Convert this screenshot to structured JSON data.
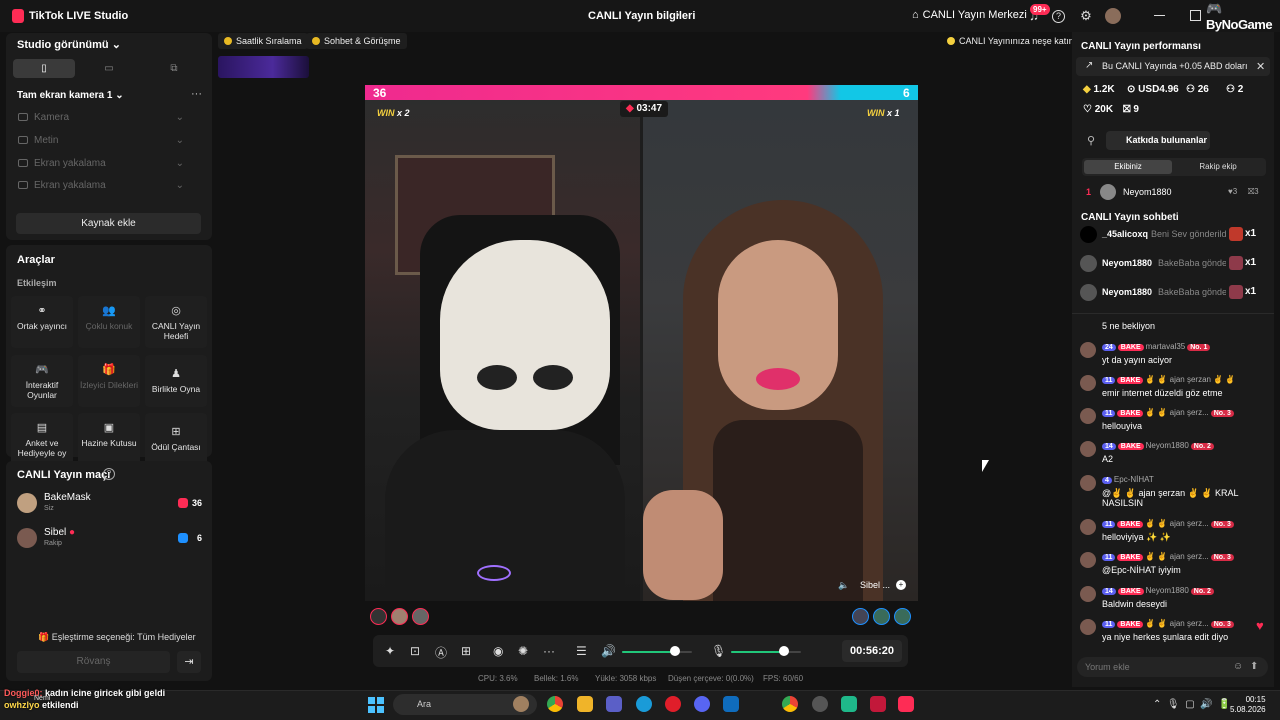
{
  "app": {
    "title": "TikTok LIVE Studio",
    "stream_info": "CANLI Yayın bilgileri",
    "center_link": "CANLI Yayın Merkezi",
    "notif_count": "99+",
    "watermark": "ByNoGame"
  },
  "left": {
    "studio_view": "Studio görünümü",
    "source_group": "Tam ekran kamera 1",
    "sources": [
      "Kamera",
      "Metin",
      "Ekran yakalama",
      "Ekran yakalama"
    ],
    "add_source": "Kaynak ekle",
    "tools_title": "Araçlar",
    "interaction_title": "Etkileşim",
    "tools": [
      {
        "label": "Ortak yayıncı",
        "icon": "link-icon"
      },
      {
        "label": "Çoklu konuk",
        "icon": "users-icon"
      },
      {
        "label": "CANLI Yayın Hedefi",
        "icon": "target-icon"
      },
      {
        "label": "İnteraktif Oyunlar",
        "icon": "gamepad-icon"
      },
      {
        "label": "İzleyici Dilekleri",
        "icon": "gift-icon"
      },
      {
        "label": "Birlikte Oyna",
        "icon": "play-together-icon"
      },
      {
        "label": "Anket ve Hediyeyle oy",
        "icon": "poll-icon"
      },
      {
        "label": "Hazine Kutusu",
        "icon": "treasure-icon"
      },
      {
        "label": "Ödül Çantası",
        "icon": "bag-icon"
      }
    ],
    "match_title": "CANLI Yayın maçı",
    "match": [
      {
        "name": "BakeMask",
        "role": "Siz",
        "score": "36",
        "color": "#fe2c55"
      },
      {
        "name": "Sibel",
        "role": "Rakip",
        "score": "6",
        "color": "#1e90ff"
      }
    ],
    "pairing": "Eşleştirme seçeneği: Tüm Hediyeler",
    "rematch": "Rövanş"
  },
  "center": {
    "chips": [
      "Saatlik Sıralama",
      "Sohbet & Görüşme",
      "CANLI Yayınınıza neşe katın"
    ],
    "score_left": "36",
    "score_right": "6",
    "timer": "03:47",
    "win_left": "x 2",
    "win_right": "x 1",
    "win_word": "WIN",
    "opponent_label": "Sibel ...",
    "elapsed": "00:56:20",
    "stats": {
      "cpu": "CPU: 3.6%",
      "mem": "Bellek: 1.6%",
      "upload": "Yükle: 3058 kbps",
      "dropped": "Düşen çerçeve: 0(0.0%)",
      "fps": "FPS: 60/60"
    },
    "volume_level": 0.75,
    "mic_level": 0.75
  },
  "right": {
    "perf_title": "CANLI Yayın performansı",
    "earn_banner": "Bu CANLI Yayında +0.05 ABD doları",
    "stats": [
      "1.2K",
      "USD4.96",
      "26",
      "2",
      "20K",
      "9"
    ],
    "contributors_btn": "Katkıda bulunanlar",
    "tab_our": "Ekibiniz",
    "tab_rival": "Rakip ekip",
    "top_contrib": {
      "rank": "1",
      "name": "Neyom1880",
      "hearts": "3",
      "gifts": "3"
    },
    "chat_title": "CANLI Yayın sohbeti",
    "gifts": [
      {
        "name": "_45alicoxq",
        "text": "Beni Sev gönderildi",
        "count": "x1"
      },
      {
        "name": "Neyom1880",
        "text": "BakeBaba gönde",
        "count": "x1"
      },
      {
        "name": "Neyom1880",
        "text": "BakeBaba gönde",
        "count": "x1"
      }
    ],
    "messages": [
      {
        "lvl": "",
        "fan": "",
        "user": "",
        "rank": "",
        "text": "5 ne bekliyon"
      },
      {
        "lvl": "24",
        "fan": "BAKE",
        "user": "martaval35",
        "rank": "No. 1",
        "text": "yt da yayın aciyor"
      },
      {
        "lvl": "11",
        "fan": "BAKE",
        "user": "✌ ✌ ajan şerzan ✌ ✌",
        "rank": "",
        "text": "emir internet düzeldi göz etme"
      },
      {
        "lvl": "11",
        "fan": "BAKE",
        "user": "✌ ✌ ajan şerz...",
        "rank": "No. 3",
        "text": "hellouyiva"
      },
      {
        "lvl": "14",
        "fan": "BAKE",
        "user": "Neyom1880",
        "rank": "No. 2",
        "text": "A2"
      },
      {
        "lvl": "4",
        "fan": "",
        "user": "Epc-NİHAT",
        "rank": "",
        "text": "@✌ ✌ ajan şerzan ✌ ✌ KRAL NASILSIN"
      },
      {
        "lvl": "11",
        "fan": "BAKE",
        "user": "✌ ✌ ajan şerz...",
        "rank": "No. 3",
        "text": "helloviyiya ✨ ✨"
      },
      {
        "lvl": "11",
        "fan": "BAKE",
        "user": "✌ ✌ ajan şerz...",
        "rank": "No. 3",
        "text": "@Epc-NİHAT iyiyim"
      },
      {
        "lvl": "14",
        "fan": "BAKE",
        "user": "Neyom1880",
        "rank": "No. 2",
        "text": "Baldwin deseydi"
      },
      {
        "lvl": "11",
        "fan": "BAKE",
        "user": "✌ ✌ ajan şerz...",
        "rank": "No. 3",
        "text": "ya niye herkes şunlara edit diyo"
      }
    ],
    "comment_placeholder": "Yorum ekle"
  },
  "overlay": {
    "line1_user": "Doggie0:",
    "line1_text": "kadın icine giricek gibi geldi",
    "line2_user": "owhzlyo",
    "line2_text": "etkilendi",
    "mini_user": "Neml"
  },
  "taskbar": {
    "search_placeholder": "Ara",
    "time": "00:15",
    "date": "5.08.2026"
  }
}
